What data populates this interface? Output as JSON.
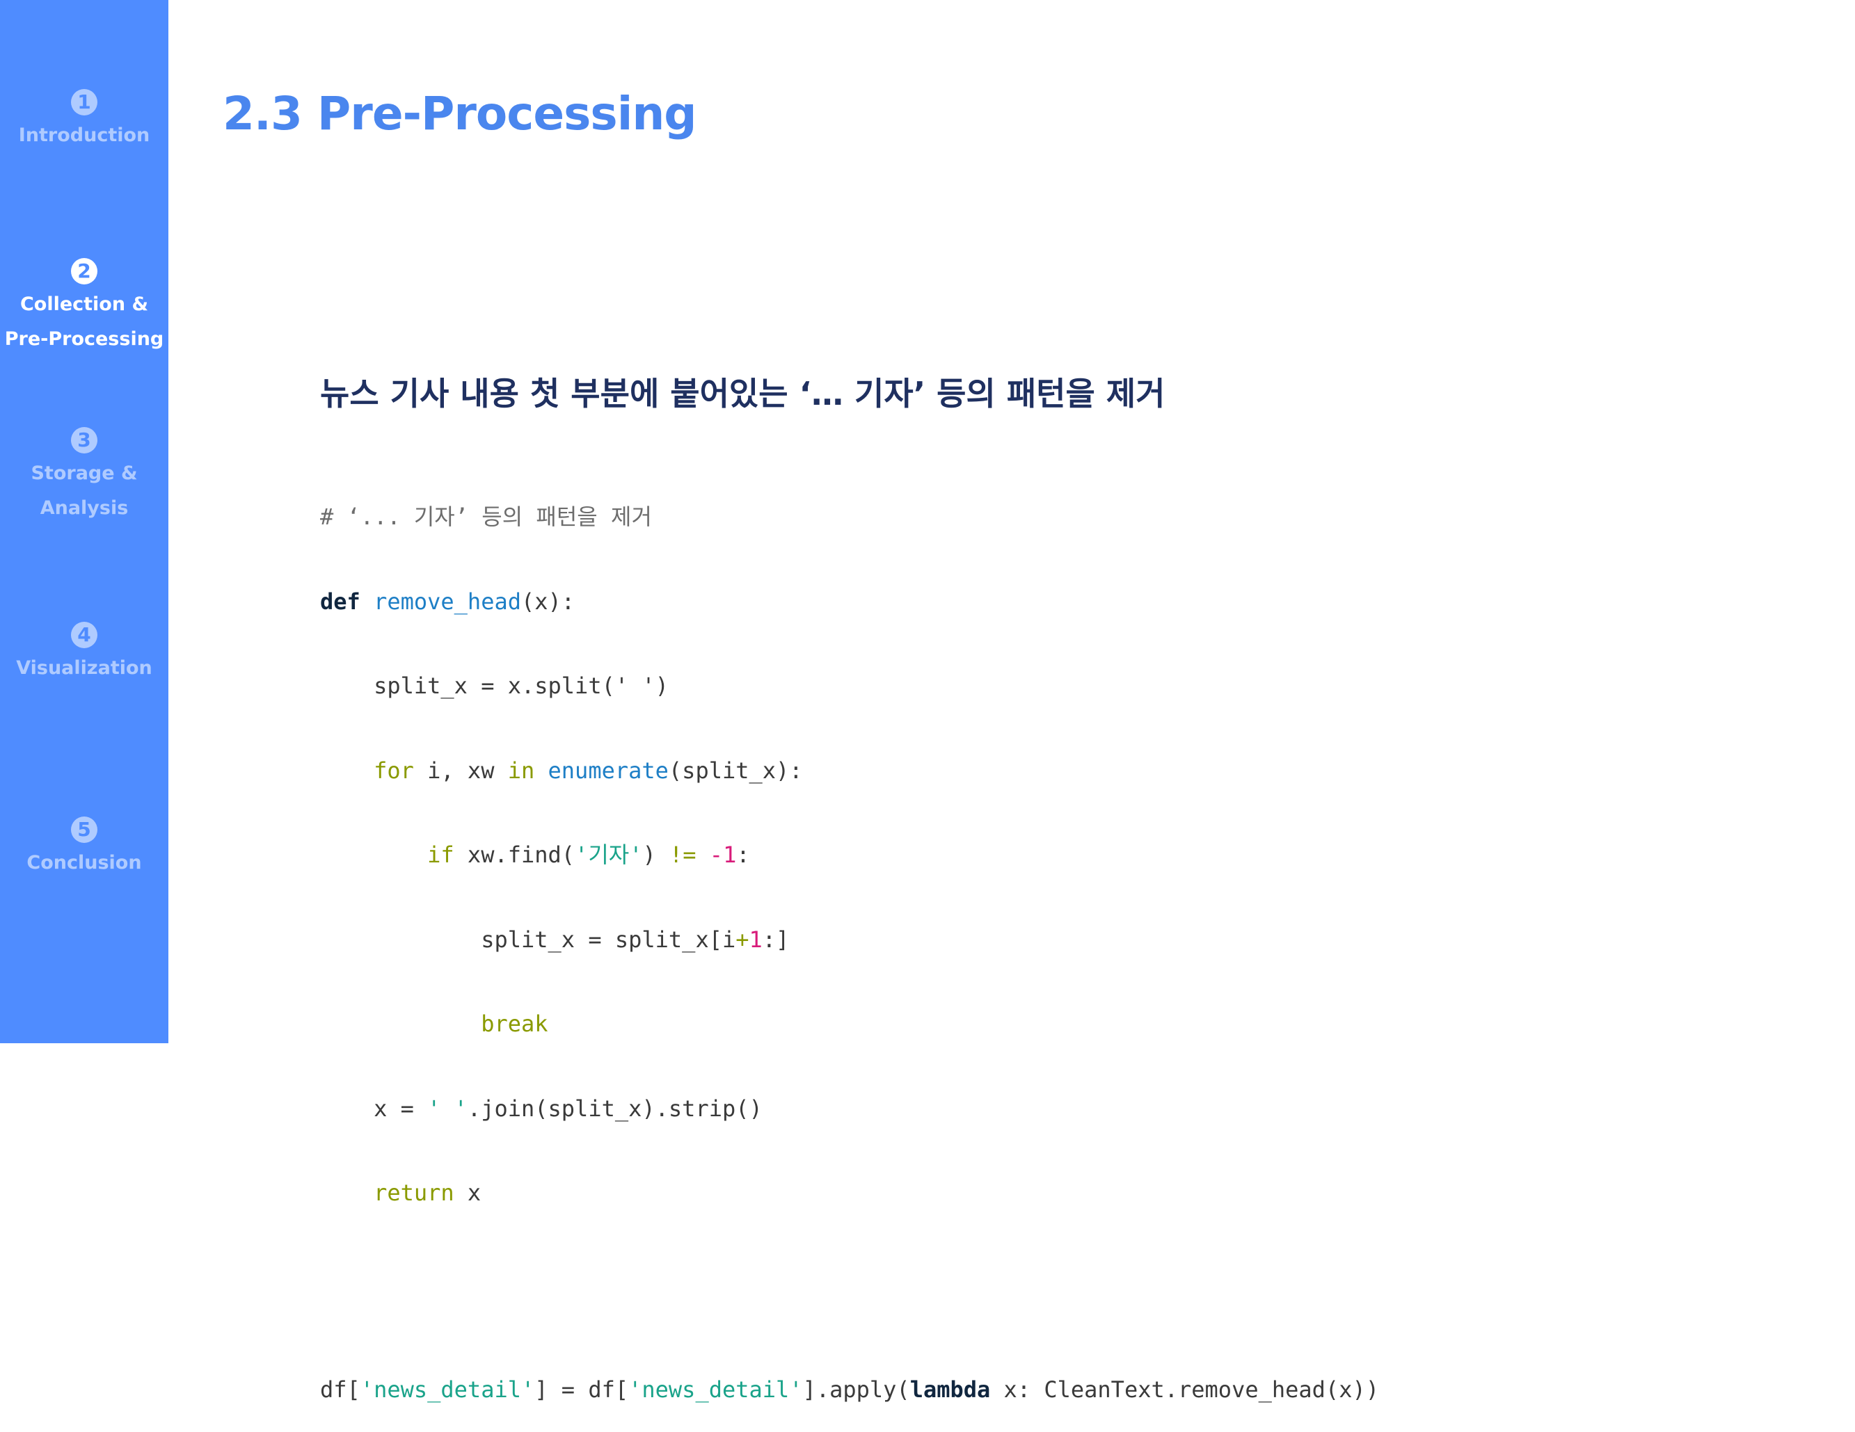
{
  "sidebar": {
    "accent": "#4f8cff",
    "items": [
      {
        "number": "1",
        "label_lines": [
          "Introduction"
        ],
        "active": false
      },
      {
        "number": "2",
        "label_lines": [
          "Collection &",
          "Pre-Processing"
        ],
        "active": true
      },
      {
        "number": "3",
        "label_lines": [
          "Storage &",
          "Analysis"
        ],
        "active": false
      },
      {
        "number": "4",
        "label_lines": [
          "Visualization"
        ],
        "active": false
      },
      {
        "number": "5",
        "label_lines": [
          "Conclusion"
        ],
        "active": false
      }
    ]
  },
  "main": {
    "title": "2.3 Pre-Processing",
    "heading": "뉴스 기사 내용 첫 부분에 붙어있는 ‘… 기자’ 등의 패턴을 제거",
    "code": {
      "comment": "# ‘... 기자’ 등의 패턴을 제거",
      "def_kw": "def",
      "func_name": "remove_head",
      "def_rest": "(x):",
      "line2": "    split_x = x.split(' ')",
      "for_kw": "for",
      "for_mid": " i, xw ",
      "in_kw": "in",
      "enumerate_fn": "enumerate",
      "for_rest": "(split_x):",
      "if_kw": "if",
      "if_mid": " xw.find(",
      "if_str": "'기자'",
      "if_close": ") ",
      "if_op": "!=",
      "if_sp": " ",
      "if_num": "-1",
      "if_colon": ":",
      "split_pre": "split_x = split_x[i",
      "split_plus": "+",
      "split_one": "1",
      "split_rest": ":]",
      "break_kw": "break",
      "join_pre": "x = ",
      "join_str": "' '",
      "join_rest": ".join(split_x).strip()",
      "return_kw": "return",
      "return_rest": " x",
      "apply_a": "df[",
      "apply_s1": "'news_detail'",
      "apply_b": "] = df[",
      "apply_s2": "'news_detail'",
      "apply_c": "].apply(",
      "apply_lambda": "lambda",
      "apply_d": " x: CleanText.remove_head(x))"
    }
  }
}
